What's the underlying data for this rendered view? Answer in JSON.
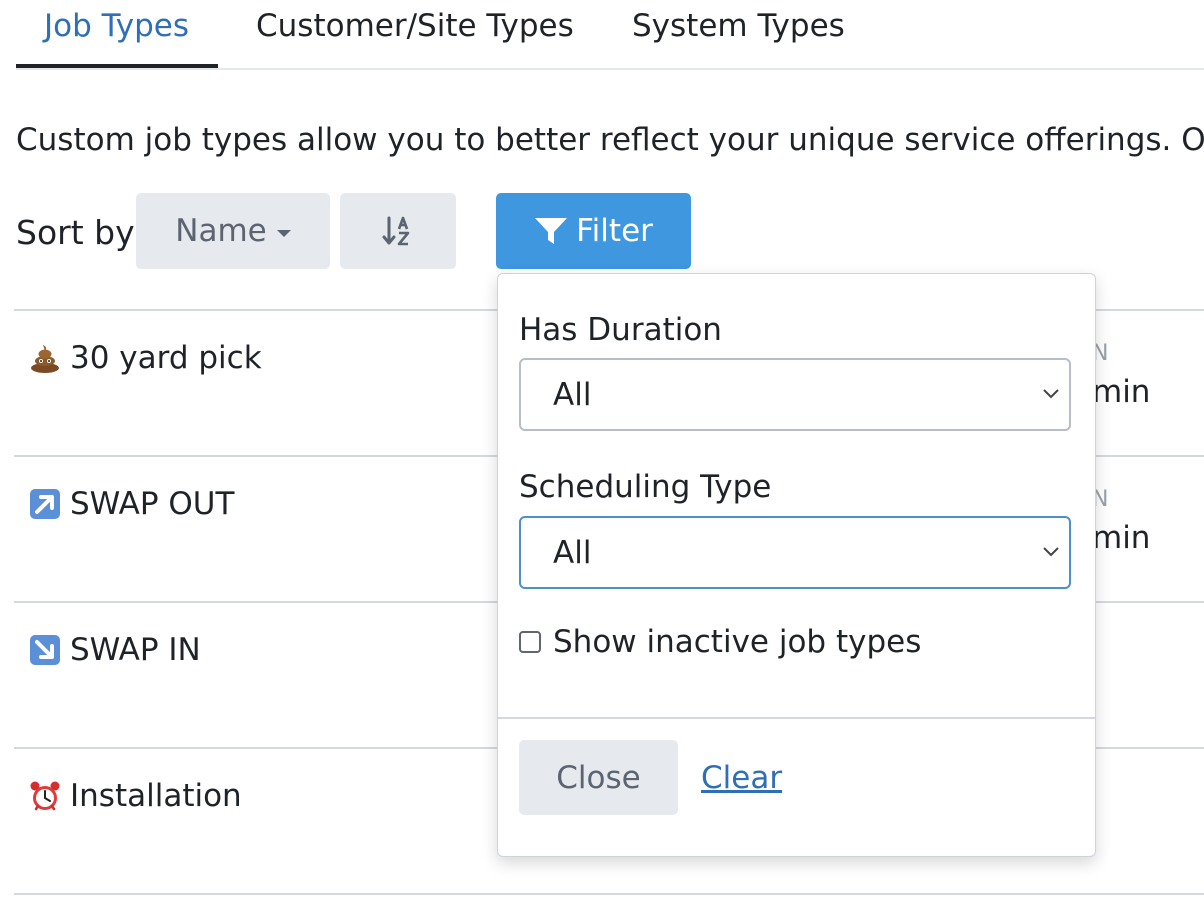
{
  "tabs": [
    {
      "label": "Job Types",
      "active": true
    },
    {
      "label": "Customer/Site Types",
      "active": false
    },
    {
      "label": "System Types",
      "active": false
    }
  ],
  "description": "Custom job types allow you to better reflect your unique service offerings. Order",
  "toolbar": {
    "sort_label": "Sort by",
    "sort_field": "Name",
    "sort_order_icon": "sort-alpha-asc-icon",
    "filter_label": "Filter",
    "filter_icon": "funnel-icon"
  },
  "job_types": [
    {
      "name": "30 yard pick",
      "icon": "poop-emoji"
    },
    {
      "name": "SWAP OUT",
      "icon": "up-right-arrow-emoji"
    },
    {
      "name": "SWAP IN",
      "icon": "down-right-arrow-emoji"
    },
    {
      "name": "Installation",
      "icon": "alarm-clock-emoji"
    }
  ],
  "partial_column": {
    "header_fragment": "N",
    "value_fragment": "min"
  },
  "filter_popover": {
    "has_duration": {
      "label": "Has Duration",
      "value": "All"
    },
    "scheduling_type": {
      "label": "Scheduling Type",
      "value": "All"
    },
    "show_inactive": {
      "label": "Show inactive job types",
      "checked": false
    },
    "close_label": "Close",
    "clear_label": "Clear"
  },
  "colors": {
    "accent": "#3f97df",
    "active_tab": "#2f6fb7",
    "link": "#2f6fb7"
  }
}
